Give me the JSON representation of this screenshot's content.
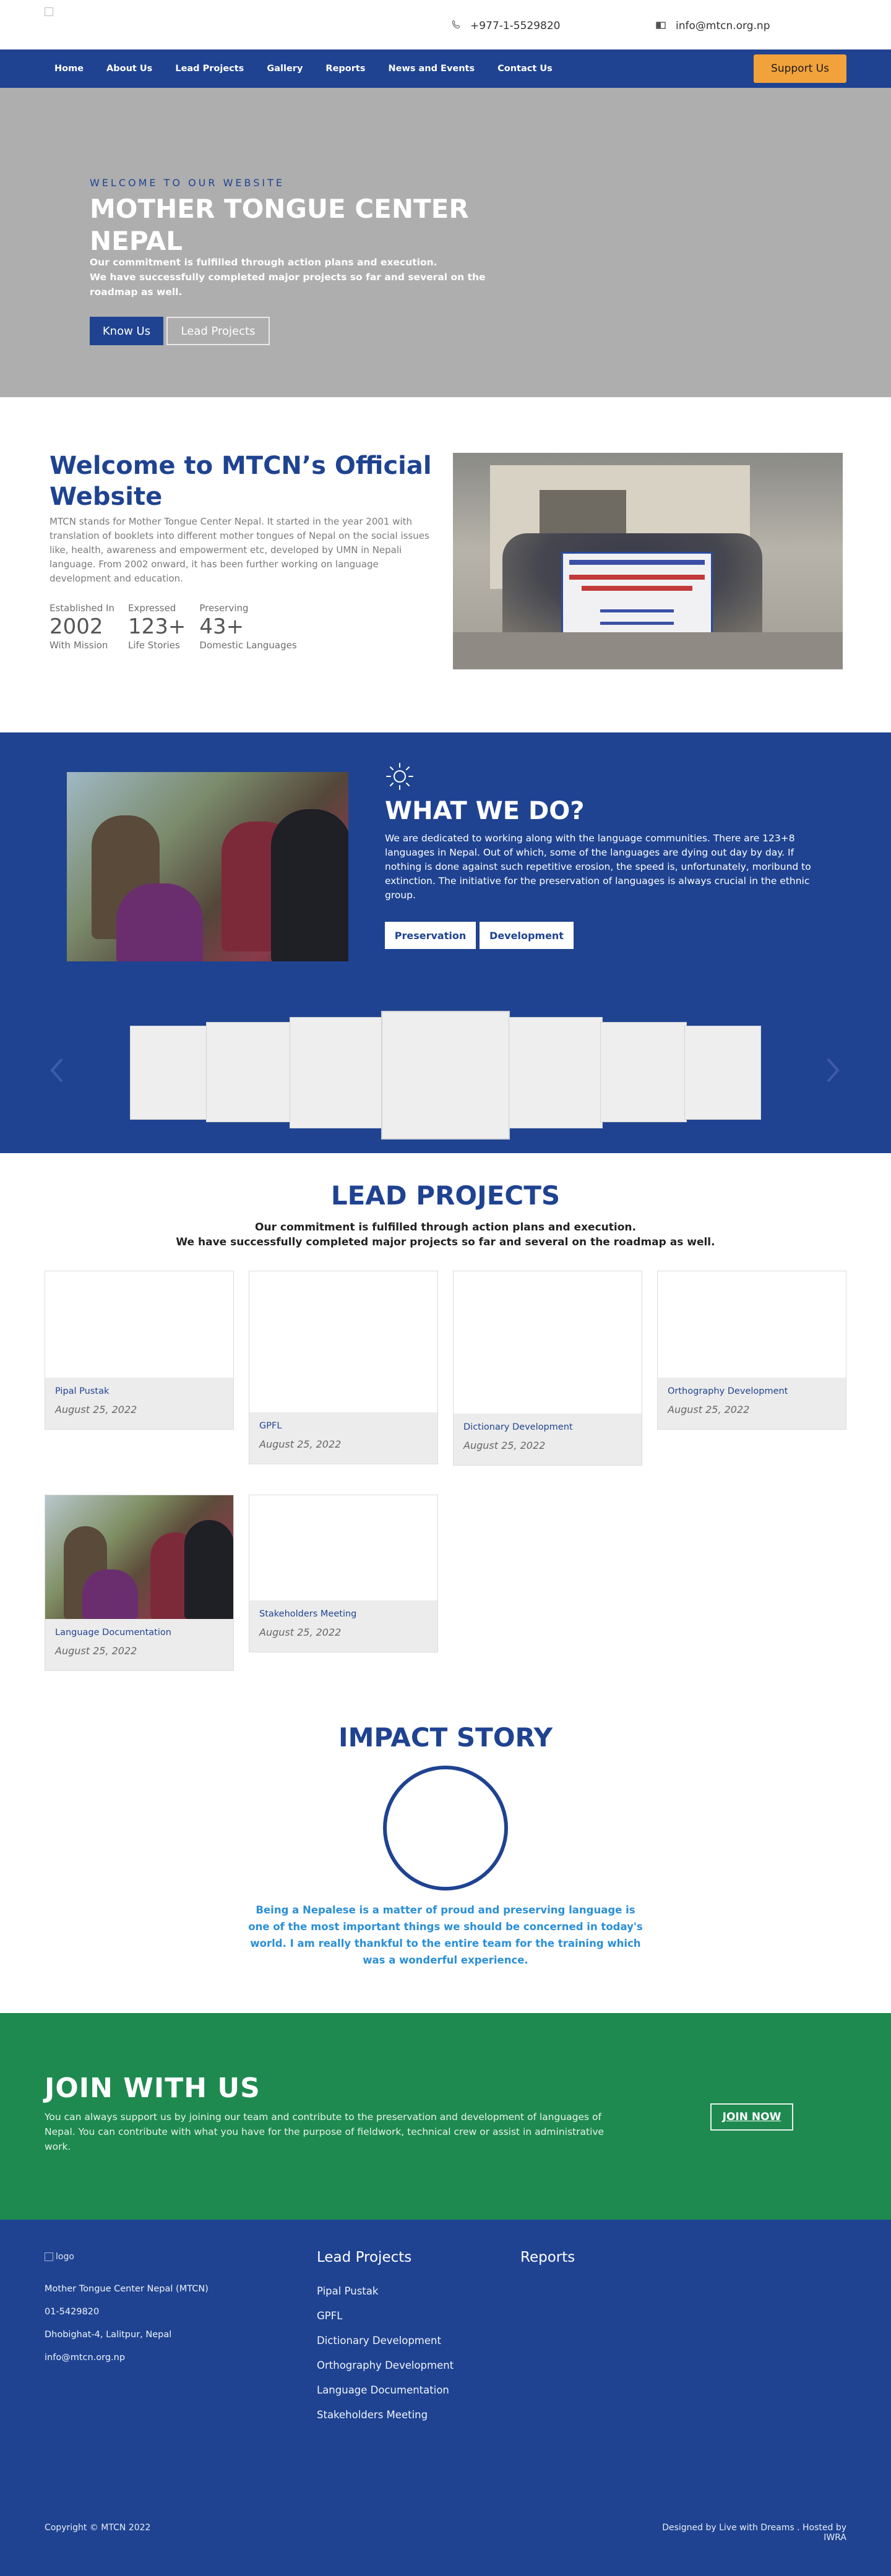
{
  "header": {
    "logo_alt": "",
    "phone": "+977-1-5529820",
    "email": "info@mtcn.org.np",
    "phone_icon": "phone-icon",
    "email_icon": "envelope-icon"
  },
  "nav": {
    "items": [
      "Home",
      "About Us",
      "Lead Projects",
      "Gallery",
      "Reports",
      "News and Events",
      "Contact Us"
    ],
    "support_label": "Support Us"
  },
  "hero": {
    "kicker": "WELCOME TO OUR WEBSITE",
    "title": "MOTHER TONGUE CENTER NEPAL",
    "lead_line1": "Our commitment is fulfilled through action plans and execution.",
    "lead_line2": "We have successfully completed major projects so far and several on the roadmap as well.",
    "btn_know": "Know Us",
    "btn_lead": "Lead Projects"
  },
  "welcome": {
    "title": "Welcome to MTCN’s Official Website",
    "description": "MTCN stands for Mother Tongue Center Nepal. It started in the year 2001 with translation of booklets into different mother tongues of Nepal on the social issues like, health, awareness and empowerment etc, developed by UMN in Nepali language. From 2002 onward, it has been further working on language development and education.",
    "stats": [
      {
        "label": "Established In",
        "value": "2002",
        "sub": "With Mission"
      },
      {
        "label": "Expressed",
        "value": "123+",
        "sub": "Life Stories"
      },
      {
        "label": "Preserving",
        "value": "43+",
        "sub": "Domestic Languages"
      }
    ]
  },
  "whatwedo": {
    "title": "WHAT WE DO?",
    "text": "We are dedicated to working along with the language communities. There are 123+8 languages in Nepal. Out of which, some of the languages are dying out day by day. If nothing is done against such repetitive erosion, the speed is, unfortunately, moribund to extinction. The initiative for the preservation of languages is always crucial in the ethnic group.",
    "btn_preservation": "Preservation",
    "btn_development": "Development",
    "sun_icon": "sun-icon"
  },
  "lead_projects": {
    "title": "LEAD PROJECTS",
    "sub_line1": "Our commitment is fulfilled through action plans and execution.",
    "sub_line2": "We have successfully completed major projects so far and several on the roadmap as well.",
    "items": [
      {
        "title": "Pipal Pustak",
        "date": "August 25, 2022"
      },
      {
        "title": "GPFL",
        "date": "August 25, 2022"
      },
      {
        "title": "Dictionary Development",
        "date": "August 25, 2022"
      },
      {
        "title": "Orthography Development",
        "date": "August 25, 2022"
      },
      {
        "title": "Language Documentation",
        "date": "August 25, 2022"
      },
      {
        "title": "Stakeholders Meeting",
        "date": "August 25, 2022"
      }
    ]
  },
  "impact": {
    "title": "IMPACT STORY",
    "quote": "Being a Nepalese is a matter of proud and preserving language is one of the most important things we should be concerned in today's world. I am really thankful to the entire team for the training which was a wonderful experience."
  },
  "join": {
    "title": "JOIN WITH US",
    "text": "You can always support us by joining our team and contribute to the preservation and development of languages of Nepal. You can contribute with what you have for the purpose of fieldwork, technical crew or assist in administrative work.",
    "btn": "JOIN NOW"
  },
  "footer": {
    "logo_alt": "logo",
    "org": "Mother Tongue Center Nepal (MTCN)",
    "phone": "01-5429820",
    "address": "Dhobighat-4, Lalitpur, Nepal",
    "email": "info@mtcn.org.np",
    "col_projects": "Lead Projects",
    "col_reports": "Reports",
    "links": [
      "Pipal Pustak",
      "GPFL",
      "Dictionary Development",
      "Orthography Development",
      "Language Documentation",
      "Stakeholders Meeting"
    ],
    "copyright": "Copyright © MTCN 2022",
    "credits": "Designed by Live with Dreams . Hosted by IWRA"
  }
}
